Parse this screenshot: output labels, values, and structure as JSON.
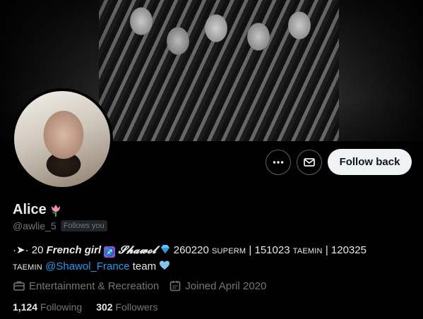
{
  "profile": {
    "display_name": "Alice",
    "handle": "@awlie_5",
    "follows_you_badge": "Follows you"
  },
  "actions": {
    "more_icon": "more-horizontal-icon",
    "message_icon": "envelope-icon",
    "follow_label": "Follow back"
  },
  "bio": {
    "prefix": "·➤·",
    "age": "20",
    "french_girl": "French girl",
    "shawol": "𝓢𝓱𝓪𝔀𝓸𝓵",
    "dates_part1": "260220",
    "superm": "SUPERM",
    "dates_part2": "| 151023",
    "taemin1": "TAEMIN",
    "dates_part3": "| 120325",
    "taemin2": "TAEMIN",
    "mention": "@Shawol_France",
    "team": "team"
  },
  "meta": {
    "category": "Entertainment & Recreation",
    "joined": "Joined April 2020"
  },
  "stats": {
    "following_count": "1,124",
    "following_label": "Following",
    "followers_count": "302",
    "followers_label": "Followers"
  },
  "colors": {
    "accent": "#1d9bf0",
    "muted": "#71767b",
    "text": "#e7e9ea",
    "button_bg": "#eff3f4"
  }
}
